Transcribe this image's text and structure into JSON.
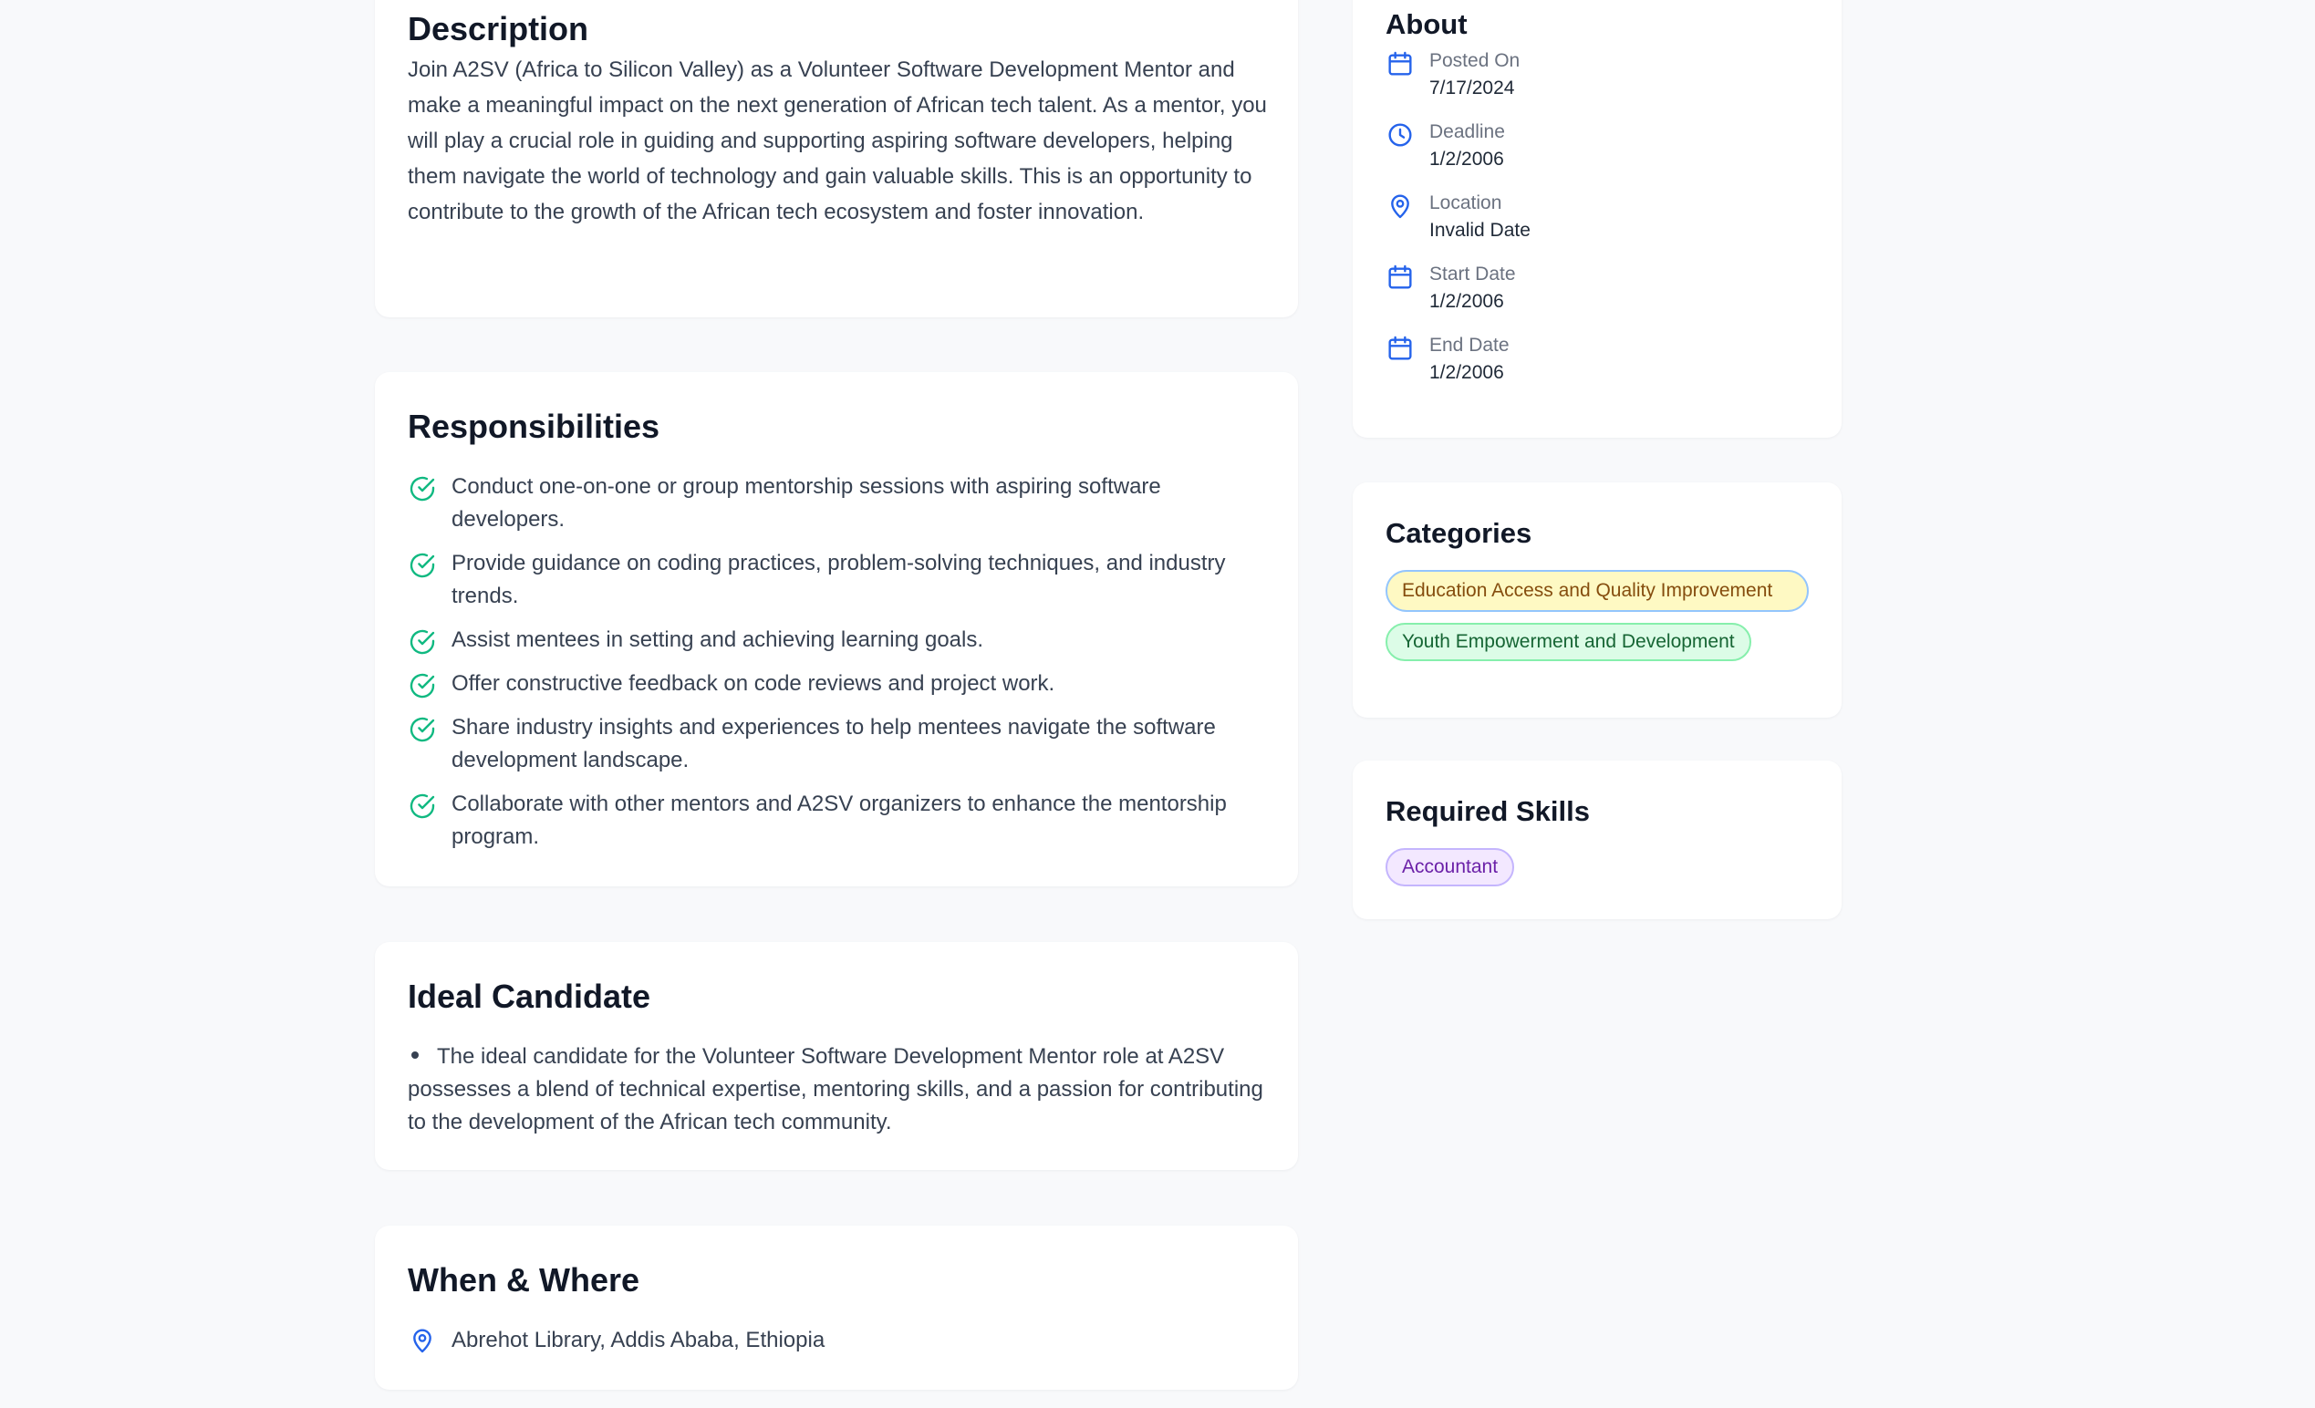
{
  "description": {
    "title": "Description",
    "body": "Join A2SV (Africa to Silicon Valley) as a Volunteer Software Development Mentor and make a meaningful impact on the next generation of African tech talent. As a mentor, you will play a crucial role in guiding and supporting aspiring software developers, helping them navigate the world of technology and gain valuable skills. This is an opportunity to contribute to the growth of the African tech ecosystem and foster innovation."
  },
  "responsibilities": {
    "title": "Responsibilities",
    "items": [
      "Conduct one-on-one or group mentorship sessions with aspiring software developers.",
      "Provide guidance on coding practices, problem-solving techniques, and industry trends.",
      "Assist mentees in setting and achieving learning goals.",
      "Offer constructive feedback on code reviews and project work.",
      "Share industry insights and experiences to help mentees navigate the software development landscape.",
      "Collaborate with other mentors and A2SV organizers to enhance the mentorship program."
    ]
  },
  "ideal_candidate": {
    "title": "Ideal Candidate",
    "text": "The ideal candidate for the Volunteer Software Development Mentor role at A2SV possesses a blend of technical expertise, mentoring skills, and a passion for contributing to the development of the African tech community."
  },
  "when_where": {
    "title": "When & Where",
    "location": "Abrehot Library, Addis Ababa, Ethiopia"
  },
  "about": {
    "title": "About",
    "items": [
      {
        "icon": "calendar-icon",
        "label": "Posted On",
        "value": "7/17/2024"
      },
      {
        "icon": "clock-icon",
        "label": "Deadline",
        "value": "1/2/2006"
      },
      {
        "icon": "location-pin-icon",
        "label": "Location",
        "value": "Invalid Date"
      },
      {
        "icon": "calendar-icon",
        "label": "Start Date",
        "value": "1/2/2006"
      },
      {
        "icon": "calendar-icon",
        "label": "End Date",
        "value": "1/2/2006"
      }
    ]
  },
  "categories": {
    "title": "Categories",
    "items": [
      "Education Access and Quality Improvement",
      "Youth Empowerment and Development"
    ]
  },
  "required_skills": {
    "title": "Required Skills",
    "items": [
      "Accountant"
    ]
  },
  "colors": {
    "icon_blue": "#2563eb",
    "check_green": "#10b981",
    "page_bg": "#f8f9fb"
  }
}
